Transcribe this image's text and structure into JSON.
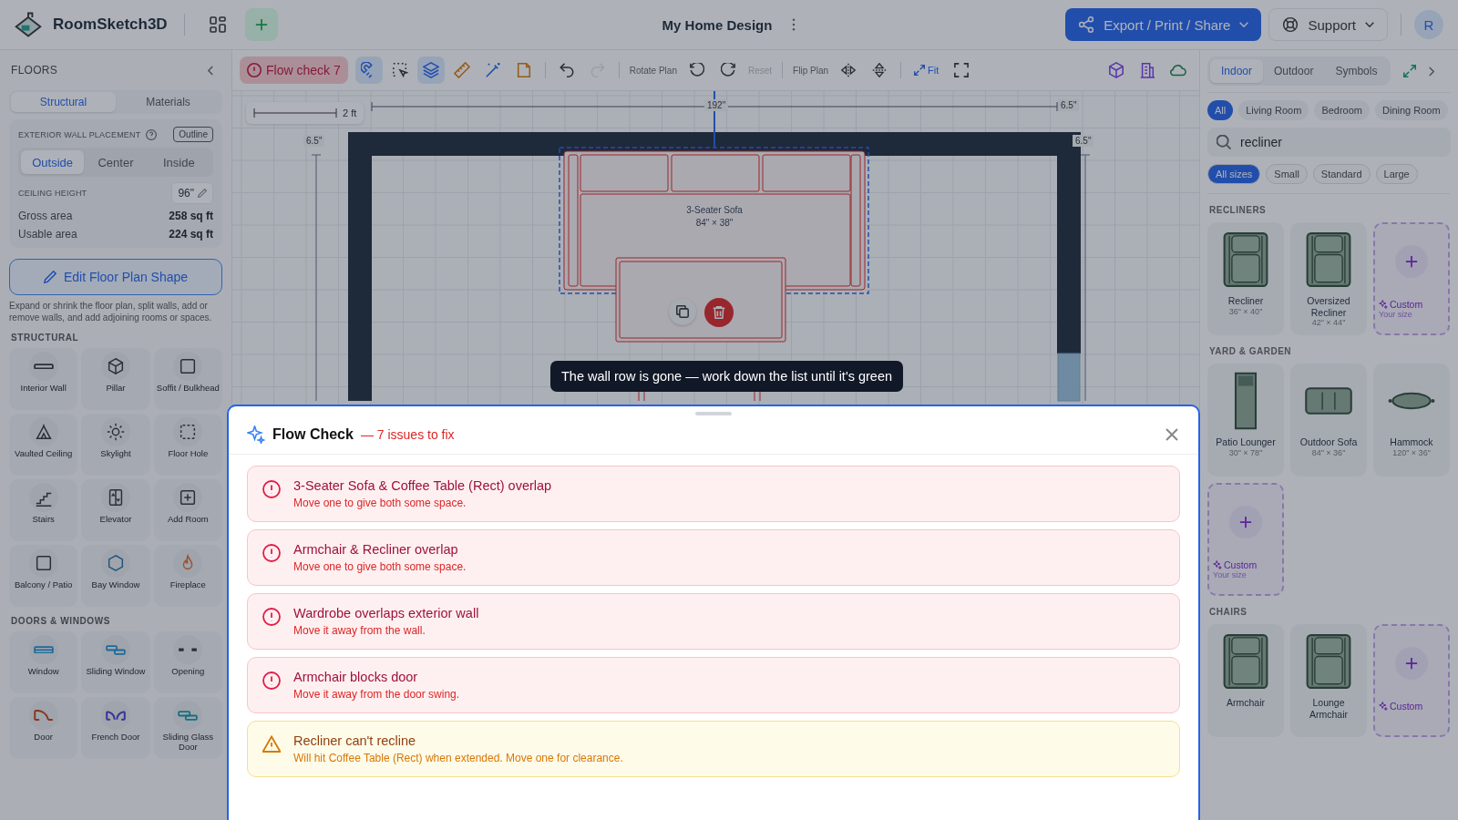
{
  "app": {
    "name": "RoomSketch3D",
    "avatar": "R"
  },
  "document": {
    "title": "My Home Design"
  },
  "header_buttons": [
    {
      "label": "Export / Print / Share",
      "kind": "primary"
    },
    {
      "label": "Support",
      "kind": "secondary"
    }
  ],
  "toolbar": {
    "flow_check": "Flow check 7",
    "tools": [
      {
        "selected": true
      },
      {
        "selected": false
      },
      {
        "selected": true
      },
      {
        "selected": false
      },
      {
        "selected": false
      },
      {
        "selected": false
      }
    ],
    "history": [
      {
        "disabled": false
      },
      {
        "disabled": true
      }
    ],
    "rotate_label": "Rotate Plan",
    "reset": {
      "label": "Reset",
      "disabled": true
    },
    "flip_label": "Flip Plan",
    "fit": "Fit"
  },
  "left_panel": {
    "title": "FLOORS",
    "tabs": [
      {
        "label": "Structural",
        "selected": true
      },
      {
        "label": "Materials",
        "selected": false
      }
    ],
    "wall_placement": {
      "label": "EXTERIOR WALL PLACEMENT",
      "outline": "Outline",
      "options": [
        {
          "label": "Outside",
          "selected": true
        },
        {
          "label": "Center",
          "selected": false
        },
        {
          "label": "Inside",
          "selected": false
        }
      ]
    },
    "ceiling": {
      "label": "CEILING HEIGHT",
      "value": "96\""
    },
    "stats": [
      {
        "label": "Gross area",
        "value": "258 sq ft"
      },
      {
        "label": "Usable area",
        "value": "224 sq ft"
      }
    ],
    "edit_button": "Edit Floor Plan Shape",
    "help": "Expand or shrink the floor plan, split walls, add or remove walls, and add adjoining rooms or spaces.",
    "sections": [
      {
        "title": "STRUCTURAL",
        "items": [
          "Interior Wall",
          "Pillar",
          "Soffit / Bulkhead",
          "Vaulted Ceiling",
          "Skylight",
          "Floor Hole",
          "Stairs",
          "Elevator",
          "Add Room",
          "Balcony / Patio",
          "Bay Window",
          "Fireplace"
        ]
      },
      {
        "title": "DOORS & WINDOWS",
        "items": [
          "Window",
          "Sliding Window",
          "Opening",
          "Door",
          "French Door",
          "Sliding Glass Door"
        ]
      }
    ]
  },
  "right_panel": {
    "tabs": [
      {
        "label": "Indoor",
        "selected": true
      },
      {
        "label": "Outdoor",
        "selected": false
      },
      {
        "label": "Symbols",
        "selected": false
      }
    ],
    "rooms": [
      {
        "label": "All",
        "selected": true
      },
      {
        "label": "Living Room",
        "selected": false
      },
      {
        "label": "Bedroom",
        "selected": false
      },
      {
        "label": "Dining Room",
        "selected": false
      }
    ],
    "search": {
      "value": "recliner"
    },
    "sizes": [
      {
        "label": "All sizes",
        "selected": true
      },
      {
        "label": "Small",
        "selected": false
      },
      {
        "label": "Standard",
        "selected": false
      },
      {
        "label": "Large",
        "selected": false
      }
    ],
    "groups": [
      {
        "title": "RECLINERS",
        "items": [
          {
            "kind": "chair",
            "name": "Recliner",
            "size": "36\" × 40\""
          },
          {
            "kind": "chair",
            "name": "Oversized Recliner",
            "size": "42\" × 44\""
          },
          {
            "kind": "custom",
            "name": "Custom",
            "size": "Your size"
          }
        ]
      },
      {
        "title": "YARD & GARDEN",
        "items": [
          {
            "kind": "lounger",
            "name": "Patio Lounger",
            "size": "30\" × 78\""
          },
          {
            "kind": "sofa",
            "name": "Outdoor Sofa",
            "size": "84\" × 36\""
          },
          {
            "kind": "hammock",
            "name": "Hammock",
            "size": "120\" × 36\""
          },
          {
            "kind": "custom",
            "name": "Custom",
            "size": "Your size"
          }
        ]
      },
      {
        "title": "CHAIRS",
        "items": [
          {
            "kind": "chair",
            "name": "Armchair"
          },
          {
            "kind": "chair",
            "name": "Lounge Armchair"
          },
          {
            "kind": "custom",
            "name": "Custom"
          }
        ]
      }
    ]
  },
  "canvas": {
    "scale": "2 ft",
    "width_dim": "192\"",
    "edge_dims": [
      "6.5\"",
      "6.5\"",
      "6.5\""
    ],
    "sofa": {
      "name": "3-Seater Sofa",
      "size": "84\" × 38\""
    }
  },
  "tooltip": "The wall row is gone — work down the list until it's green",
  "flow_check": {
    "title": "Flow Check",
    "summary": "— 7 issues to fix",
    "issues": [
      {
        "kind": "error",
        "title": "3-Seater Sofa & Coffee Table (Rect) overlap",
        "detail": "Move one to give both some space."
      },
      {
        "kind": "error",
        "title": "Armchair & Recliner overlap",
        "detail": "Move one to give both some space."
      },
      {
        "kind": "error",
        "title": "Wardrobe overlaps exterior wall",
        "detail": "Move it away from the wall."
      },
      {
        "kind": "error",
        "title": "Armchair blocks door",
        "detail": "Move it away from the door swing."
      },
      {
        "kind": "warning",
        "title": "Recliner can't recline",
        "detail": "Will hit Coffee Table (Rect) when extended. Move one for clearance."
      }
    ]
  }
}
